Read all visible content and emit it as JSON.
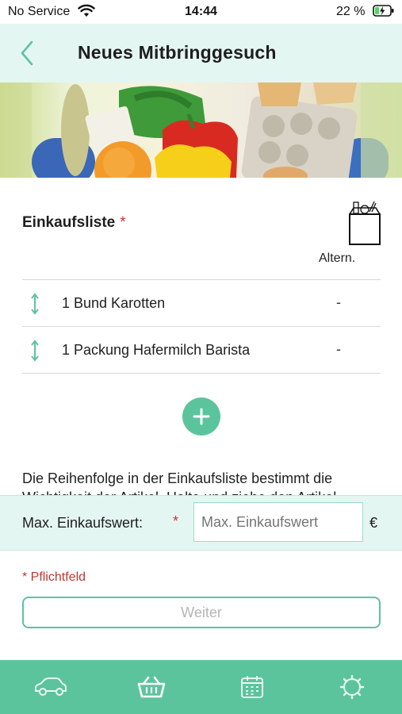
{
  "status_bar": {
    "carrier": "No Service",
    "time": "14:44",
    "battery_percent": "22 %",
    "icons": [
      "wifi-icon",
      "battery-charging-icon"
    ]
  },
  "header": {
    "title": "Neues Mitbringgesuch",
    "back_icon": "chevron-left-icon"
  },
  "hero": {
    "description_icon": "grocery-banner-image"
  },
  "shopping_list": {
    "title": "Einkaufsliste",
    "required_marker": "*",
    "alternatives_label": "Altern.",
    "items": [
      {
        "name": "1 Bund Karotten",
        "alternative": "-"
      },
      {
        "name": "1 Packung Hafermilch Barista",
        "alternative": "-"
      }
    ],
    "add_icon": "plus-icon"
  },
  "hint": "Die Reihenfolge in der Einkaufsliste bestimmt die Wichtigkeit der Artikel. Halte und ziehe den Artikel",
  "max_value": {
    "label": "Max. Einkaufswert:",
    "required_marker": "*",
    "placeholder": "Max. Einkaufswert",
    "value": "",
    "currency": "€"
  },
  "required_note": "* Pflichtfeld",
  "next_button": "Weiter",
  "tabbar": {
    "items": [
      {
        "name": "car-icon",
        "active": false
      },
      {
        "name": "basket-icon",
        "active": true
      },
      {
        "name": "calendar-icon",
        "active": false
      },
      {
        "name": "settings-gear-icon",
        "active": false
      }
    ]
  },
  "colors": {
    "accent": "#5cc49c",
    "header_bg": "#e4f6f1",
    "required": "#d32f2f",
    "tab_icon": "#e8f7f1"
  }
}
